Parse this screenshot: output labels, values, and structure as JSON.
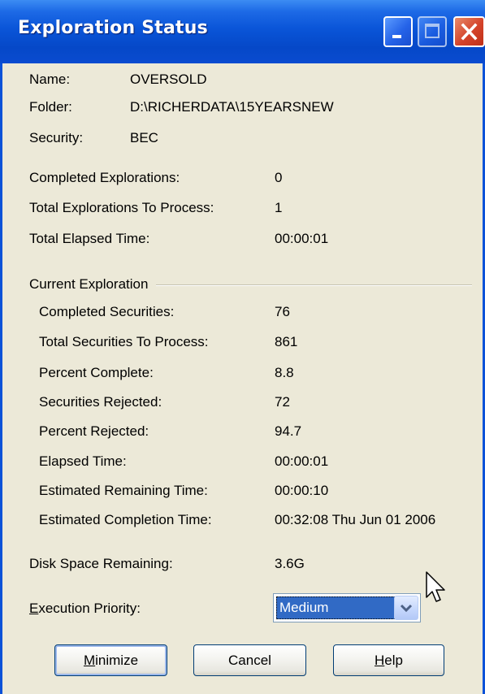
{
  "window": {
    "title": "Exploration Status"
  },
  "info": [
    {
      "label": "Name:",
      "value": "OVERSOLD"
    },
    {
      "label": "Folder:",
      "value": "D:\\RICHERDATA\\15YEARSNEW"
    },
    {
      "label": "Security:",
      "value": "BEC"
    }
  ],
  "totals": [
    {
      "label": "Completed Explorations:",
      "value": "0"
    },
    {
      "label": "Total Explorations To Process:",
      "value": "1"
    },
    {
      "label": "Total Elapsed Time:",
      "value": "00:00:01"
    }
  ],
  "current": {
    "group_title": "Current Exploration",
    "rows": [
      {
        "label": "Completed Securities:",
        "value": "76"
      },
      {
        "label": "Total Securities To Process:",
        "value": "861"
      },
      {
        "label": "Percent Complete:",
        "value": "8.8"
      },
      {
        "label": "Securities Rejected:",
        "value": "72"
      },
      {
        "label": "Percent Rejected:",
        "value": "94.7"
      },
      {
        "label": "Elapsed Time:",
        "value": "00:00:01"
      },
      {
        "label": "Estimated Remaining Time:",
        "value": "00:00:10"
      },
      {
        "label": "Estimated Completion Time:",
        "value": "00:32:08 Thu Jun 01 2006"
      }
    ]
  },
  "disk": {
    "label": "Disk Space Remaining:",
    "value": "3.6G"
  },
  "priority": {
    "label_first": "E",
    "label_rest": "xecution Priority:",
    "selected": "Medium"
  },
  "buttons": {
    "minimize": {
      "first": "M",
      "rest": "inimize"
    },
    "cancel": "Cancel",
    "help": {
      "first": "H",
      "rest": "elp"
    }
  },
  "icons": {
    "minimize": "minimize-icon",
    "maximize": "maximize-icon",
    "close": "close-icon",
    "dropdown": "chevron-down-icon",
    "cursor": "mouse-pointer-icon"
  }
}
